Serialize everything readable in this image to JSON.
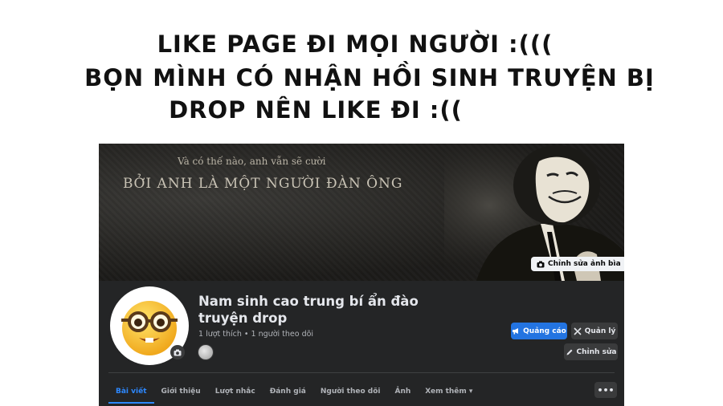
{
  "headline": {
    "line1": "LIKE PAGE ĐI MỌI NGƯỜI :(((",
    "line2": "BỌN MÌNH CÓ NHẬN HỒI SINH TRUYỆN BỊ",
    "line3": "DROP NÊN LIKE ĐI :(("
  },
  "cover": {
    "subtitle": "Và có thế nào, anh vẫn sẽ cười",
    "main_text": "BỞI ANH LÀ MỘT NGƯỜI ĐÀN ÔNG",
    "edit_label": "Chỉnh sửa ảnh bìa",
    "edit_icon": "camera-icon"
  },
  "page": {
    "title": "Nam sinh cao trung bí ẩn đào truyện drop",
    "stats": "1 lượt thích • 1 người theo dõi"
  },
  "actions": {
    "ads_label": "Quảng cáo",
    "ads_icon": "megaphone-icon",
    "manage_label": "Quản lý",
    "manage_icon": "manage-icon",
    "edit_label": "Chỉnh sửa",
    "edit_icon": "pencil-icon"
  },
  "tabs": [
    {
      "label": "Bài viết",
      "active": true
    },
    {
      "label": "Giới thiệu"
    },
    {
      "label": "Lượt nhắc"
    },
    {
      "label": "Đánh giá"
    },
    {
      "label": "Người theo dõi"
    },
    {
      "label": "Ảnh"
    },
    {
      "label": "Xem thêm ▾"
    }
  ],
  "more_label": "•••",
  "colors": {
    "accent": "#2374e1",
    "panel": "#242526",
    "button": "#3a3b3c",
    "text_primary": "#e4e6eb",
    "text_secondary": "#b0b3b8"
  }
}
